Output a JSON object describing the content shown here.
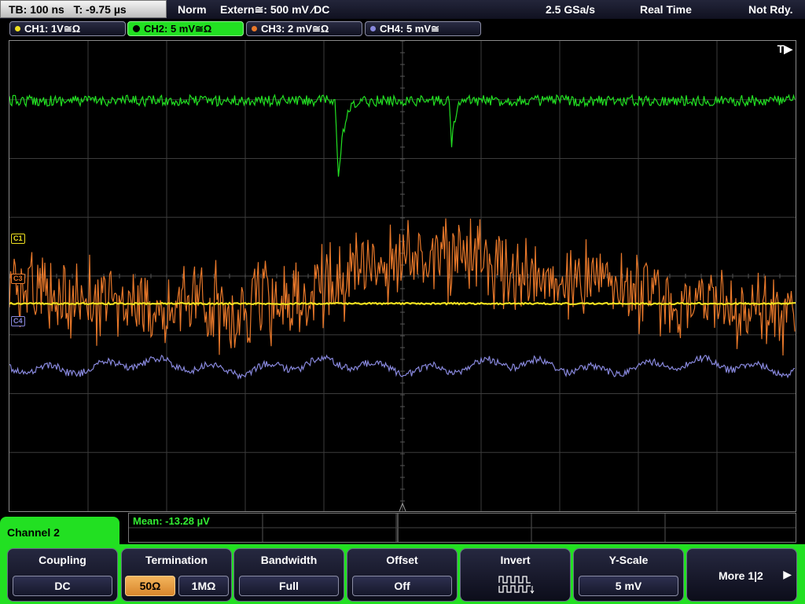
{
  "topbar": {
    "timebase": "TB: 100 ns",
    "trigger_time": "T: -9.75 µs",
    "trigger_mode": "Norm",
    "trigger_source": "Extern≅: 500 mV ⁄DC",
    "sample_rate": "2.5 GSa/s",
    "acq_mode": "Real Time",
    "status": "Not Rdy."
  },
  "channels": [
    {
      "label": "CH1: 1V≅Ω",
      "color": "#f0e020"
    },
    {
      "label": "CH2: 5 mV≅Ω",
      "color": "#22e022"
    },
    {
      "label": "CH3: 2 mV≅Ω",
      "color": "#e8782a"
    },
    {
      "label": "CH4: 5 mV≅",
      "color": "#8888dd"
    }
  ],
  "plot": {
    "trigger_marker": "T▶",
    "markers": {
      "c1": "C1",
      "c3": "C3",
      "c4": "C4"
    }
  },
  "measurement": {
    "label": "Mean: -13.28 µV"
  },
  "panel": {
    "title": "Channel 2",
    "coupling": {
      "title": "Coupling",
      "value": "DC"
    },
    "termination": {
      "title": "Termination",
      "opt1": "50Ω",
      "opt2": "1MΩ"
    },
    "bandwidth": {
      "title": "Bandwidth",
      "value": "Full"
    },
    "offset": {
      "title": "Offset",
      "value": "Off"
    },
    "invert": {
      "title": "Invert"
    },
    "yscale": {
      "title": "Y-Scale",
      "value": "5 mV"
    },
    "more": {
      "label": "More 1|2"
    }
  },
  "colors": {
    "grid": "#3c3c3c",
    "ch1": "#f0e020",
    "ch2": "#22e022",
    "ch3": "#e8782a",
    "ch4": "#8888dd"
  }
}
